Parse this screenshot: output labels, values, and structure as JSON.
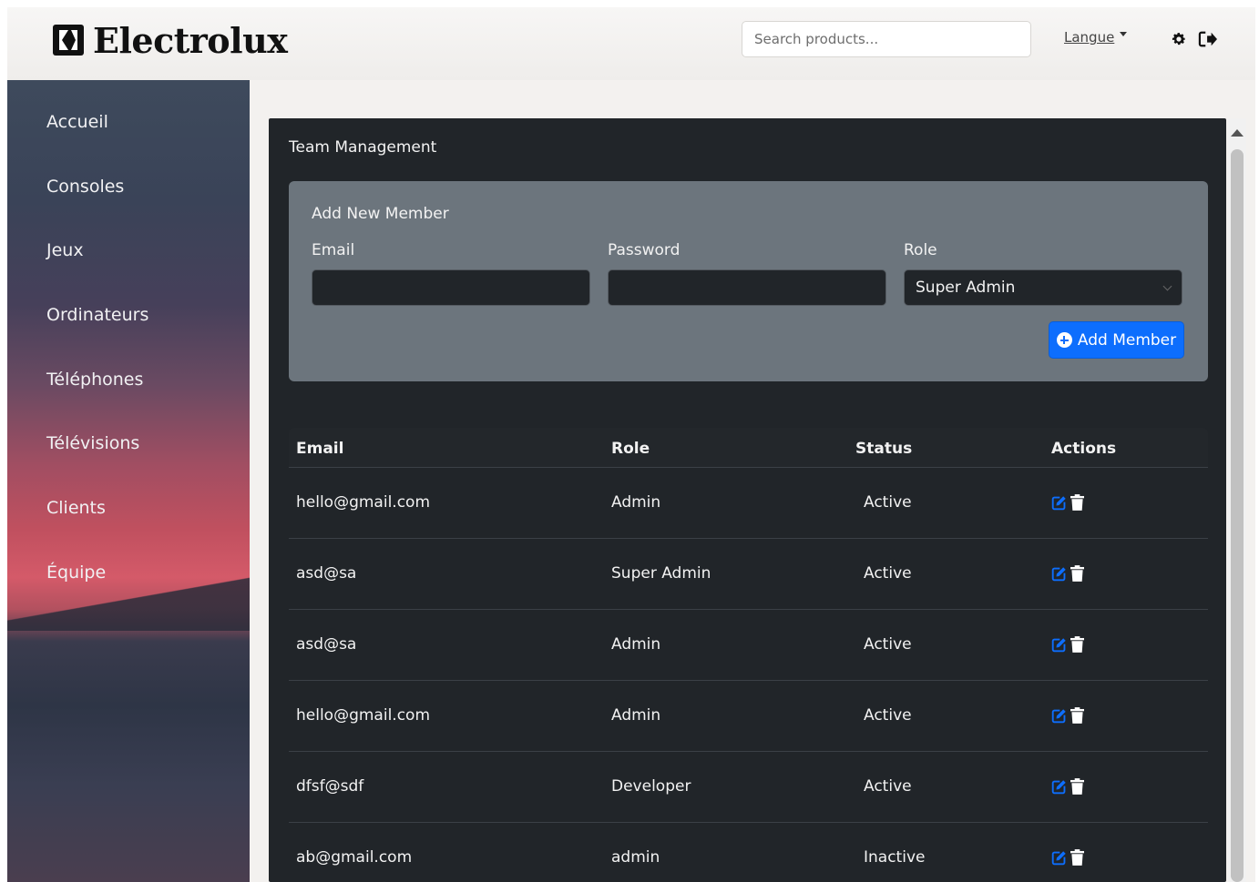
{
  "header": {
    "brand": "Electrolux",
    "search_placeholder": "Search products...",
    "language_label": "Langue",
    "icons": [
      "settings-gear-icon",
      "logout-icon"
    ]
  },
  "sidebar": {
    "items": [
      {
        "label": "Accueil"
      },
      {
        "label": "Consoles"
      },
      {
        "label": "Jeux"
      },
      {
        "label": "Ordinateurs"
      },
      {
        "label": "Téléphones"
      },
      {
        "label": "Télévisions"
      },
      {
        "label": "Clients"
      },
      {
        "label": "Équipe"
      }
    ]
  },
  "main": {
    "title": "Team Management",
    "form": {
      "title": "Add New Member",
      "email_label": "Email",
      "email_value": "",
      "password_label": "Password",
      "password_value": "",
      "role_label": "Role",
      "role_selected": "Super Admin",
      "submit_label": "Add Member"
    },
    "table": {
      "columns": [
        "Email",
        "Role",
        "Status",
        "Actions"
      ],
      "rows": [
        {
          "email": "hello@gmail.com",
          "role": "Admin",
          "status": "Active"
        },
        {
          "email": "asd@sa",
          "role": "Super Admin",
          "status": "Active"
        },
        {
          "email": "asd@sa",
          "role": "Admin",
          "status": "Active"
        },
        {
          "email": "hello@gmail.com",
          "role": "Admin",
          "status": "Active"
        },
        {
          "email": "dfsf@sdf",
          "role": "Developer",
          "status": "Active"
        },
        {
          "email": "ab@gmail.com",
          "role": "admin",
          "status": "Inactive"
        }
      ]
    }
  },
  "colors": {
    "primary": "#0d6efd",
    "panel_dark": "#212529",
    "form_card": "#6c757d",
    "edit_icon": "#0d6efd",
    "delete_icon": "#ffffff"
  }
}
